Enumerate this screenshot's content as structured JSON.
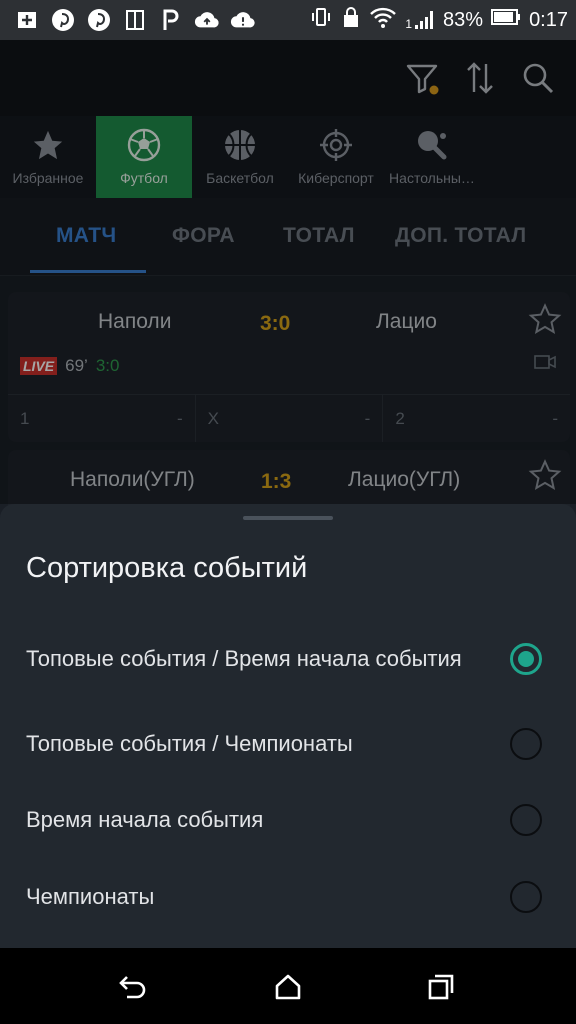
{
  "status_bar": {
    "battery_percent": "83%",
    "time": "0:17",
    "signal": "1",
    "icons_left": [
      "add-icon",
      "pinterest-icon",
      "pinterest-icon",
      "reader-icon",
      "p-app-icon",
      "cloud-upload-icon",
      "cloud-alert-icon"
    ],
    "icons_right": [
      "vibrate-icon",
      "lock-icon",
      "wifi-icon",
      "cell-signal-icon",
      "battery-icon"
    ]
  },
  "toolbar": {
    "icons": [
      "filter-icon",
      "sort-icon",
      "search-icon"
    ],
    "filter_badge_color": "#d89a1e"
  },
  "sports": [
    {
      "label": "Избранное",
      "icon": "star-icon",
      "active": false
    },
    {
      "label": "Футбол",
      "icon": "soccer-ball-icon",
      "active": true
    },
    {
      "label": "Баскетбол",
      "icon": "basketball-icon",
      "active": false
    },
    {
      "label": "Киберспорт",
      "icon": "crosshair-icon",
      "active": false
    },
    {
      "label": "Настольны…",
      "icon": "table-tennis-icon",
      "active": false
    }
  ],
  "markets": {
    "tabs": [
      "МАТЧ",
      "ФОРА",
      "ТОТАЛ",
      "ДОП. ТОТАЛ"
    ],
    "active": "МАТЧ"
  },
  "events": [
    {
      "home": "Наполи",
      "away": "Лацио",
      "score": "3:0",
      "live_label": "LIVE",
      "minute": "69’",
      "live_score": "3:0",
      "odds": [
        {
          "label": "1",
          "value": "-"
        },
        {
          "label": "X",
          "value": "-"
        },
        {
          "label": "2",
          "value": "-"
        }
      ]
    },
    {
      "home": "Наполи(УГЛ)",
      "away": "Лацио(УГЛ)",
      "score": "1:3"
    }
  ],
  "sort_sheet": {
    "title": "Сортировка событий",
    "options": [
      {
        "label": "Топовые события / Время начала события",
        "selected": true
      },
      {
        "label": "Топовые события / Чемпионаты",
        "selected": false
      },
      {
        "label": "Время начала события",
        "selected": false
      },
      {
        "label": "Чемпионаты",
        "selected": false
      }
    ]
  },
  "nav_bar": {
    "icons": [
      "back-icon",
      "home-icon",
      "recents-icon"
    ]
  },
  "colors": {
    "accent_green": "#1f8a4a",
    "tab_active_blue": "#3a7fd0",
    "score_gold": "#d4a21a",
    "radio_teal": "#1ea58c",
    "live_red": "#c9302c"
  }
}
